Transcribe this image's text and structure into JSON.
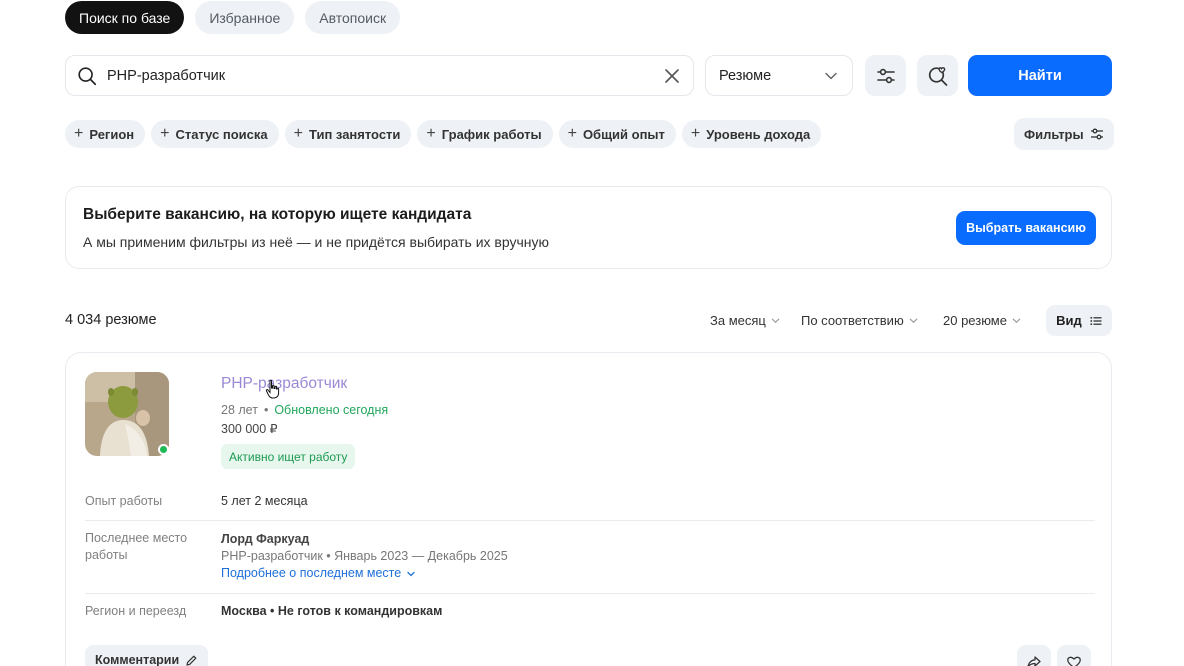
{
  "tabs": [
    {
      "label": "Поиск по базе",
      "active": true
    },
    {
      "label": "Избранное",
      "active": false
    },
    {
      "label": "Автопоиск",
      "active": false
    }
  ],
  "search": {
    "value": "PHP-разработчик",
    "type_select": "Резюме",
    "find_label": "Найти"
  },
  "filter_chips": [
    "Регион",
    "Статус поиска",
    "Тип занятости",
    "График работы",
    "Общий опыт",
    "Уровень дохода"
  ],
  "filters_label": "Фильтры",
  "banner": {
    "title": "Выберите вакансию, на которую ищете кандидата",
    "subtitle": "А мы применим фильтры из неё — и не придётся выбирать их вручную",
    "button_label": "Выбрать вакансию"
  },
  "results": {
    "count": "4 034 резюме",
    "period": "За месяц",
    "sort": "По соответствию",
    "per_page": "20 резюме",
    "view_label": "Вид"
  },
  "resume": {
    "title": "PHP-разработчик",
    "age": "28 лет",
    "updated": "Обновлено сегодня",
    "salary": "300 000 ₽",
    "status": "Активно ищет работу",
    "experience_label": "Опыт работы",
    "experience_value": "5 лет 2 месяца",
    "last_job_label": "Последнее место работы",
    "last_job_company": "Лорд Фаркуад",
    "last_job_details": "PHP-разработчик • Январь 2023 — Декабрь 2025",
    "last_job_more": "Подробнее о последнем месте",
    "region_label": "Регион и переезд",
    "region_value": "Москва • Не готов к командировкам",
    "comments_label": "Комментарии"
  },
  "colors": {
    "primary": "#0a6cff",
    "active_tab": "#121212",
    "chip_bg": "#eef1f5",
    "title_visited": "#9b89d6",
    "success": "#21a65b",
    "link": "#1e6fd9"
  }
}
